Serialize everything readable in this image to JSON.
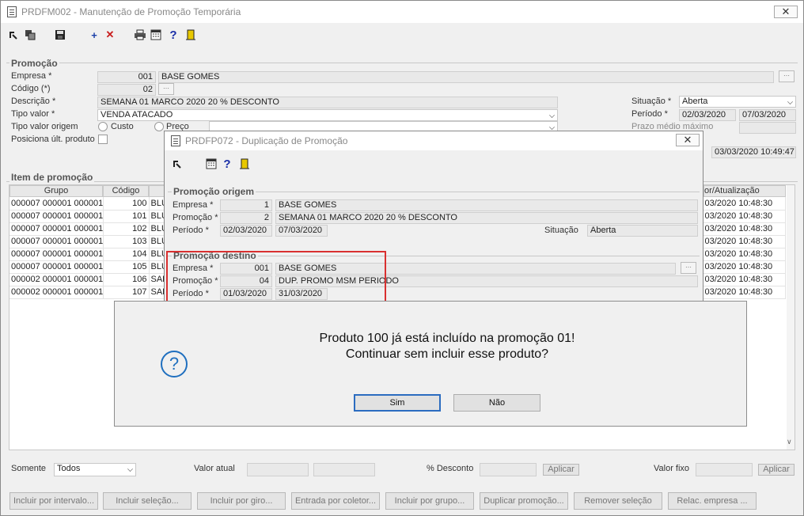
{
  "main": {
    "title": "PRDFM002 - Manutenção de Promoção Temporária",
    "close": "✕",
    "promocao": {
      "section_title": "Promoção",
      "empresa_label": "Empresa *",
      "empresa_code": "001",
      "empresa_name": "BASE GOMES",
      "codigo_label": "Código (*)",
      "codigo_value": "02",
      "descricao_label": "Descrição *",
      "descricao_value": "SEMANA 01 MARCO 2020 20 % DESCONTO",
      "tipo_valor_label": "Tipo valor *",
      "tipo_valor_value": "VENDA ATACADO",
      "tipo_valor_origem_label": "Tipo valor origem",
      "custo_label": "Custo",
      "preco_label": "Preço",
      "posiciona_label": "Posiciona últ. produto",
      "situacao_label": "Situação *",
      "situacao_value": "Aberta",
      "periodo_label": "Período *",
      "periodo_inicio": "02/03/2020",
      "periodo_fim": "07/03/2020",
      "prazo_label": "Prazo médio máximo",
      "atualizacao_value": "03/03/2020 10:49:47"
    },
    "items": {
      "section_title": "Item de promoção",
      "headers": [
        "Grupo",
        "Código",
        "or/Atualização"
      ],
      "rows": [
        {
          "grupo": "000007 000001 000001",
          "codigo": "100",
          "desc": "BLU",
          "data": "03/2020 10:48:30"
        },
        {
          "grupo": "000007 000001 000001",
          "codigo": "101",
          "desc": "BLU",
          "data": "03/2020 10:48:30"
        },
        {
          "grupo": "000007 000001 000001",
          "codigo": "102",
          "desc": "BLU",
          "data": "03/2020 10:48:30"
        },
        {
          "grupo": "000007 000001 000001",
          "codigo": "103",
          "desc": "BLU",
          "data": "03/2020 10:48:30"
        },
        {
          "grupo": "000007 000001 000001",
          "codigo": "104",
          "desc": "BLU",
          "data": "03/2020 10:48:30"
        },
        {
          "grupo": "000007 000001 000001",
          "codigo": "105",
          "desc": "BLU",
          "data": "03/2020 10:48:30"
        },
        {
          "grupo": "000002 000001 000001",
          "codigo": "106",
          "desc": "SAL",
          "data": "03/2020 10:48:30"
        },
        {
          "grupo": "000002 000001 000001",
          "codigo": "107",
          "desc": "SAL",
          "data": "03/2020 10:48:30"
        }
      ]
    },
    "bottom": {
      "somente_label": "Somente",
      "somente_value": "Todos",
      "valor_atual_label": "Valor atual",
      "desconto_label": "% Desconto",
      "aplicar1": "Aplicar",
      "valor_fixo_label": "Valor fixo",
      "aplicar2": "Aplicar"
    },
    "buttons": [
      "Incluir por intervalo...",
      "Incluir seleção...",
      "Incluir por giro...",
      "Entrada por coletor...",
      "Incluir por grupo...",
      "Duplicar promoção...",
      "Remover seleção",
      "Relac. empresa ..."
    ]
  },
  "dialog": {
    "title": "PRDFP072 - Duplicação de Promoção",
    "close": "✕",
    "origem": {
      "section_title": "Promoção origem",
      "empresa_label": "Empresa *",
      "empresa_code": "1",
      "empresa_name": "BASE GOMES",
      "promocao_label": "Promoção *",
      "promocao_code": "2",
      "promocao_name": "SEMANA 01 MARCO 2020 20 % DESCONTO",
      "periodo_label": "Período *",
      "periodo_inicio": "02/03/2020",
      "periodo_fim": "07/03/2020",
      "situacao_label": "Situação",
      "situacao_value": "Aberta"
    },
    "destino": {
      "section_title": "Promoção destino",
      "empresa_label": "Empresa *",
      "empresa_code": "001",
      "empresa_name": "BASE GOMES",
      "promocao_label": "Promoção *",
      "promocao_code": "04",
      "promocao_name": "DUP. PROMO MSM PERIODO",
      "periodo_label": "Período *",
      "periodo_inicio": "01/03/2020",
      "periodo_fim": "31/03/2020"
    },
    "highlight_color": "#d93030"
  },
  "message": {
    "line1": "Produto 100 já está incluído na promoção 01!",
    "line2": "Continuar sem incluir esse produto?",
    "yes": "Sim",
    "no": "Não",
    "icon": "question-icon",
    "icon_color": "#1f6fbf"
  }
}
